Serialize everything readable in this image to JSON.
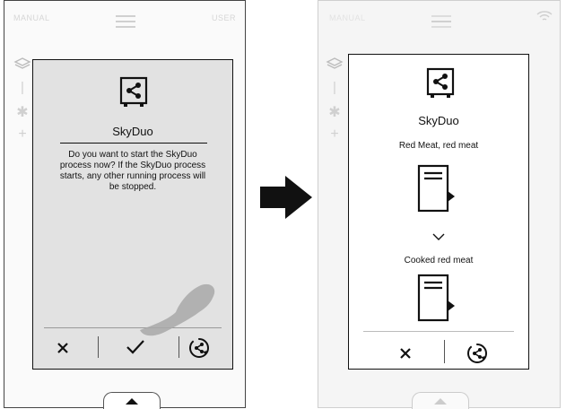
{
  "left_screen": {
    "topbar_left": "MANUAL",
    "topbar_right": "USER",
    "dialog": {
      "title": "SkyDuo",
      "message": "Do you want to start the SkyDuo process now? If the SkyDuo process starts, any other running process will be stopped."
    }
  },
  "right_screen": {
    "topbar_left": "MANUAL",
    "dialog": {
      "title": "SkyDuo",
      "step_from": "Red Meat, red meat",
      "step_to": "Cooked red meat"
    }
  },
  "icons": {
    "skyduo": "share-box-icon",
    "cancel": "close-icon",
    "confirm": "check-icon",
    "skyduo_start": "skyduo-cycle-icon",
    "arrow": "right-arrow-icon",
    "wifi": "wifi-icon",
    "hand": "pointing-hand-icon",
    "chevron": "chevron-down-icon",
    "tray": "tray-flag-icon"
  },
  "colors": {
    "dialog_gray": "#e2e2e2",
    "dialog_white": "#ffffff",
    "ink": "#111111",
    "hint": "#d0d0d0"
  }
}
